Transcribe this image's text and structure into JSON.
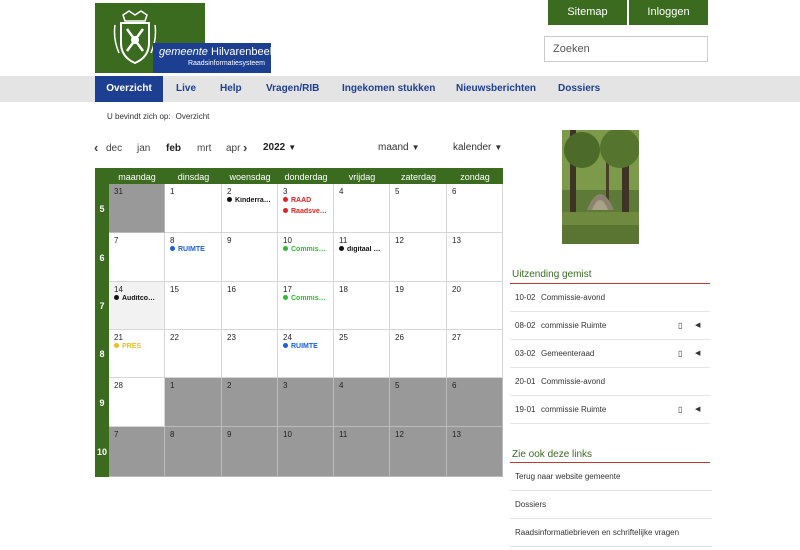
{
  "header": {
    "municipality_prefix": "gemeente",
    "municipality_name": "Hilvarenbeek",
    "system_name": "Raadsinformatiesysteem",
    "sitemap": "Sitemap",
    "login": "Inloggen",
    "search_placeholder": "Zoeken"
  },
  "nav": [
    "Overzicht",
    "Live",
    "Help",
    "Vragen/RIB",
    "Ingekomen stukken",
    "Nieuwsberichten",
    "Dossiers"
  ],
  "breadcrumb": {
    "label": "U bevindt zich op:",
    "current": "Overzicht"
  },
  "month_selector": {
    "months": [
      "dec",
      "jan",
      "feb",
      "mrt",
      "apr"
    ],
    "selected": "feb",
    "year": "2022",
    "view": "maand",
    "mode": "kalender"
  },
  "calendar": {
    "days": [
      "maandag",
      "dinsdag",
      "woensdag",
      "donderdag",
      "vrijdag",
      "zaterdag",
      "zondag"
    ],
    "weeks": [
      {
        "week": "5",
        "days": [
          {
            "date": "31",
            "gray": true
          },
          {
            "date": "1"
          },
          {
            "date": "2",
            "events": [
              {
                "label": "Kinderra…",
                "color": "#111111"
              }
            ]
          },
          {
            "date": "3",
            "events": [
              {
                "label": "RAAD",
                "color": "#e52020"
              },
              {
                "label": "Raadsve…",
                "color": "#e52020"
              }
            ]
          },
          {
            "date": "4"
          },
          {
            "date": "5"
          },
          {
            "date": "6"
          }
        ]
      },
      {
        "week": "6",
        "days": [
          {
            "date": "7"
          },
          {
            "date": "8",
            "events": [
              {
                "label": "RUIMTE",
                "color": "#1a5fe0"
              }
            ]
          },
          {
            "date": "9"
          },
          {
            "date": "10",
            "events": [
              {
                "label": "Commis…",
                "color": "#2fb92f"
              }
            ]
          },
          {
            "date": "11",
            "events": [
              {
                "label": "digitaal …",
                "color": "#111111"
              }
            ]
          },
          {
            "date": "12"
          },
          {
            "date": "13"
          }
        ]
      },
      {
        "week": "7",
        "days": [
          {
            "date": "14",
            "light": true,
            "events": [
              {
                "label": "Auditco…",
                "color": "#111111"
              }
            ]
          },
          {
            "date": "15"
          },
          {
            "date": "16"
          },
          {
            "date": "17",
            "events": [
              {
                "label": "Commis…",
                "color": "#2fb92f"
              }
            ]
          },
          {
            "date": "18"
          },
          {
            "date": "19"
          },
          {
            "date": "20"
          }
        ]
      },
      {
        "week": "8",
        "days": [
          {
            "date": "21",
            "events": [
              {
                "label": "PRES",
                "color": "#e8c020"
              }
            ]
          },
          {
            "date": "22"
          },
          {
            "date": "23"
          },
          {
            "date": "24",
            "events": [
              {
                "label": "RUIMTE",
                "color": "#1a5fe0"
              }
            ]
          },
          {
            "date": "25"
          },
          {
            "date": "26"
          },
          {
            "date": "27"
          }
        ]
      },
      {
        "week": "9",
        "days": [
          {
            "date": "28"
          },
          {
            "date": "1",
            "gray": true
          },
          {
            "date": "2",
            "gray": true
          },
          {
            "date": "3",
            "gray": true
          },
          {
            "date": "4",
            "gray": true
          },
          {
            "date": "5",
            "gray": true
          },
          {
            "date": "6",
            "gray": true
          }
        ]
      },
      {
        "week": "10",
        "days": [
          {
            "date": "7",
            "gray": true
          },
          {
            "date": "8",
            "gray": true
          },
          {
            "date": "9",
            "gray": true
          },
          {
            "date": "10",
            "gray": true
          },
          {
            "date": "11",
            "gray": true
          },
          {
            "date": "12",
            "gray": true
          },
          {
            "date": "13",
            "gray": true
          }
        ]
      }
    ]
  },
  "missed": {
    "title": "Uitzending gemist",
    "items": [
      {
        "date": "10-02",
        "title": "Commissie-avond",
        "icons": false
      },
      {
        "date": "08-02",
        "title": "commissie Ruimte",
        "icons": true
      },
      {
        "date": "03-02",
        "title": "Gemeenteraad",
        "icons": true
      },
      {
        "date": "20-01",
        "title": "Commissie-avond",
        "icons": false
      },
      {
        "date": "19-01",
        "title": "commissie Ruimte",
        "icons": true
      }
    ],
    "doc_icon": "document-icon",
    "play_icon": "play-icon"
  },
  "links": {
    "title": "Zie ook deze links",
    "items": [
      "Terug naar website gemeente",
      "Dossiers",
      "Raadsinformatiebrieven en schriftelijke vragen"
    ]
  },
  "colors": {
    "green": "#3a6b1f",
    "blue": "#1c3f92",
    "red": "#c0392b"
  }
}
